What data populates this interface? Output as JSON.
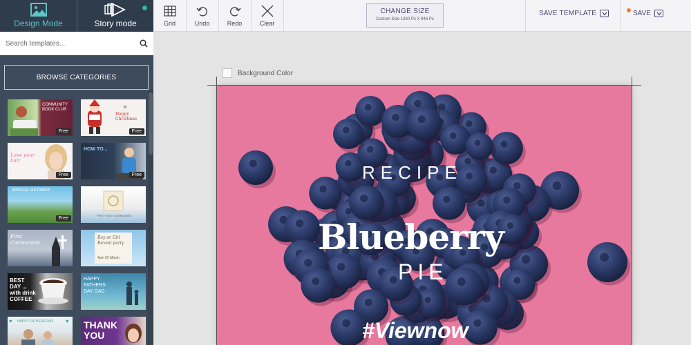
{
  "sidebar": {
    "modes": {
      "design_label": "Design Mode",
      "story_label": "Story mode"
    },
    "search_placeholder": "Search templates...",
    "browse_label": "BROWSE CATEGORIES",
    "thumbnails": {
      "t1": {
        "text": "COMMUNITY BOOK CLUB",
        "badge": "Free"
      },
      "t2": {
        "text": "Happy Christmas",
        "badge": "Free"
      },
      "t3": {
        "text": "Love your hair",
        "badge": "Free"
      },
      "t4": {
        "text": "HOW TO...",
        "badge": "Free"
      },
      "t5": {
        "text": "SPECIAL GETAWAY",
        "badge": "Free"
      },
      "t6": {
        "text": "FIRST HOLY COMMUNION"
      },
      "t7": {
        "text": "First Communion"
      },
      "t8": {
        "text": "Boy or Girl Reveal party",
        "sub": "4pm 02 March"
      },
      "t9": {
        "text": "BEST DAY ... with drink COFFEE"
      },
      "t10": {
        "text": "HAPPY FATHERS DAY DAD"
      },
      "t11": {
        "text": "HAPPY FATHERS DAY"
      },
      "t12": {
        "text": "THANK YOU"
      }
    }
  },
  "toolbar": {
    "grid_label": "Grid",
    "undo_label": "Undo",
    "redo_label": "Redo",
    "clear_label": "Clear",
    "change_size_title": "CHANGE SIZE",
    "change_size_sub": "Custom Size 1280 Px X 946 Px",
    "save_template_label": "SAVE TEMPLATE",
    "save_label": "SAVE"
  },
  "canvas": {
    "bg_color_label": "Background Color",
    "recipe": "RECIPE",
    "title": "Blueberry",
    "subtitle": "PIE",
    "hashtag": "#Viewnow"
  },
  "colors": {
    "sidebar": "#3d4b5c",
    "accent": "#5fc3c8",
    "brand_text": "#4b3f70",
    "artboard_bg": "#e8799e",
    "berry": "#2c3b6b"
  }
}
